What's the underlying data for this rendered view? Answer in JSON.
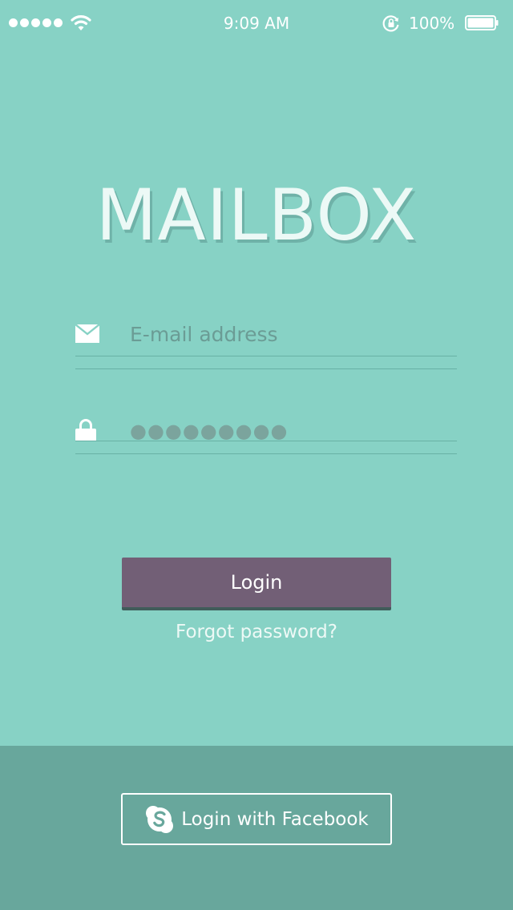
{
  "status_bar": {
    "time": "9:09 AM",
    "battery_percent": "100%",
    "signal_bars": 5,
    "icons": [
      "signal-dots-icon",
      "wifi-icon",
      "rotation-lock-icon",
      "battery-icon"
    ]
  },
  "logo": {
    "text": "MAILBOX"
  },
  "form": {
    "email": {
      "placeholder": "E-mail address",
      "value": "",
      "icon": "mail-icon"
    },
    "password": {
      "value": "●●●●●●●●●",
      "icon": "lock-icon"
    }
  },
  "actions": {
    "login_label": "Login",
    "forgot_label": "Forgot password?"
  },
  "footer": {
    "social_label": "Login with Facebook",
    "social_icon": "skype-icon"
  },
  "colors": {
    "background": "#87d2c5",
    "footer_background": "#68a79c",
    "login_button": "#725f76",
    "logo_text": "#ecf9f6",
    "field_text": "#6b9c95"
  }
}
